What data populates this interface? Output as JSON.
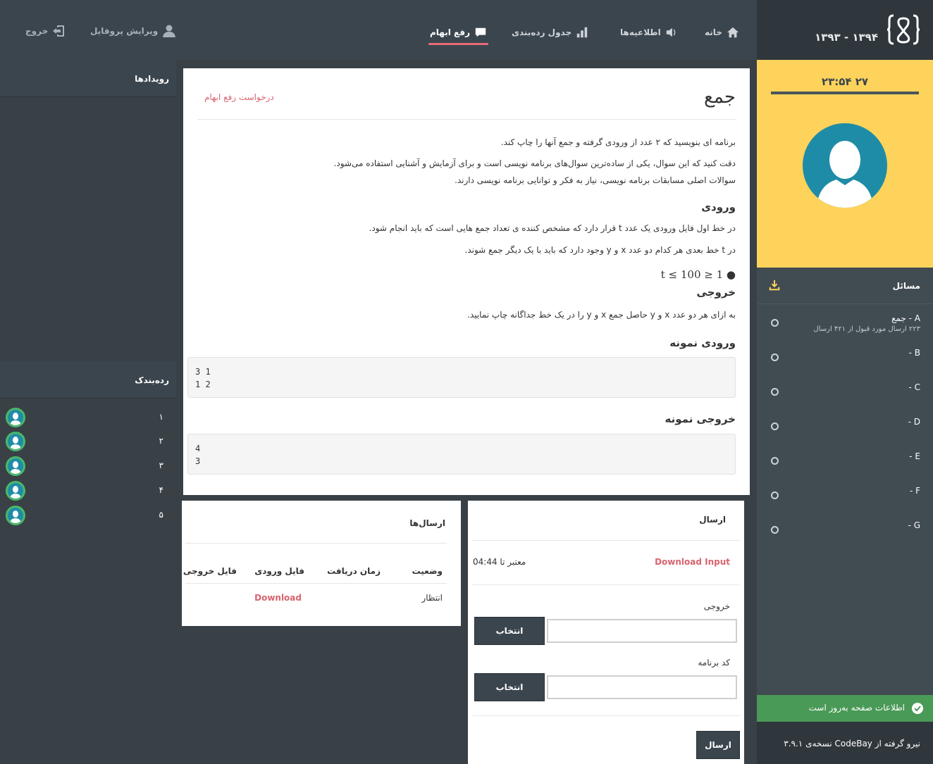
{
  "brand": {
    "years": "۱۳۹۳ - ۱۳۹۴"
  },
  "nav": {
    "home": "خانه",
    "announcements": "اطلاعیه‌ها",
    "scoreboard": "جدول رده‌بندی",
    "clarification": "رفع ابهام",
    "edit_profile": "ویرایش پروفایل",
    "logout": "خروج"
  },
  "timer": {
    "value": "۲۳:۵۴ ۲۷"
  },
  "problems": {
    "title": "مسائل",
    "items": [
      {
        "label": "A - جمع",
        "sub": "۲۲۳ ارسال مورد قبول از ۴۲۱ ارسال"
      },
      {
        "label": "B -"
      },
      {
        "label": "C -"
      },
      {
        "label": "D -"
      },
      {
        "label": "E -"
      },
      {
        "label": "F -"
      },
      {
        "label": "G -"
      }
    ]
  },
  "status": {
    "text": "اطلاعات صفحه به‌روز است",
    "color": "#4a9a57"
  },
  "footer": {
    "powered": "نیرو گرفته از  CodeBay  نسخه‌ی ۳.۹.۱"
  },
  "left": {
    "events_title": "رویدادها",
    "ranking_title": "رده‌بندک",
    "ranks": [
      "۱",
      "۲",
      "۳",
      "۴",
      "۵"
    ]
  },
  "problem": {
    "title": "جمع",
    "clarify_link": "درخواست رفع ابهام",
    "p1": "برنامه ای بنویسید که ۲ عدد از ورودی گرفته و جمع آنها را چاپ کند.",
    "p2": "دقت کنید که این سوال، یکی از ساده‌ترین سوال‌های برنامه نویسی است و برای آزمایش و آشنایی استفاده می‌شود.",
    "p3": "سوالات اصلی مسابقات برنامه نویسی، نیاز به فکر و توانایی برنامه نویسی دارند.",
    "input_title": "ورودی",
    "in1": "در خط اول فایل ورودی یک عدد t قرار دارد که مشخص کننده ی تعداد جمع هایی است که باید انجام شود.",
    "in2": "در t خط بعدی هر کدام دو عدد x و y وجود دارد که باید با یک دیگر جمع شوند.",
    "constraint": "1 ≤ t ≤ 100",
    "output_title": "خروجی",
    "out1": "به ازای هر دو عدد x و y حاصل جمع x و y را در یک خط جداگانه چاپ نمایید.",
    "sample_in_title": "ورودی نمونه",
    "sample_in": "3 1\n1 2",
    "sample_out_title": "خروجی نمونه",
    "sample_out": "4\n3"
  },
  "submissions": {
    "title": "ارسال‌ها",
    "headers": {
      "status": "وضعیت",
      "time": "زمان دریافت",
      "input": "فایل ورودی",
      "output": "فایل خروجی"
    },
    "rows": [
      {
        "status": "انتظار",
        "time": "",
        "input": "Download",
        "output": ""
      }
    ]
  },
  "submit": {
    "title": "ارسال",
    "download_input": "Download Input",
    "valid_until": "معتبر تا 04:44",
    "output_label": "خروجی",
    "code_label": "کد برنامه",
    "choose": "انتخاب",
    "send": "ارسال"
  }
}
